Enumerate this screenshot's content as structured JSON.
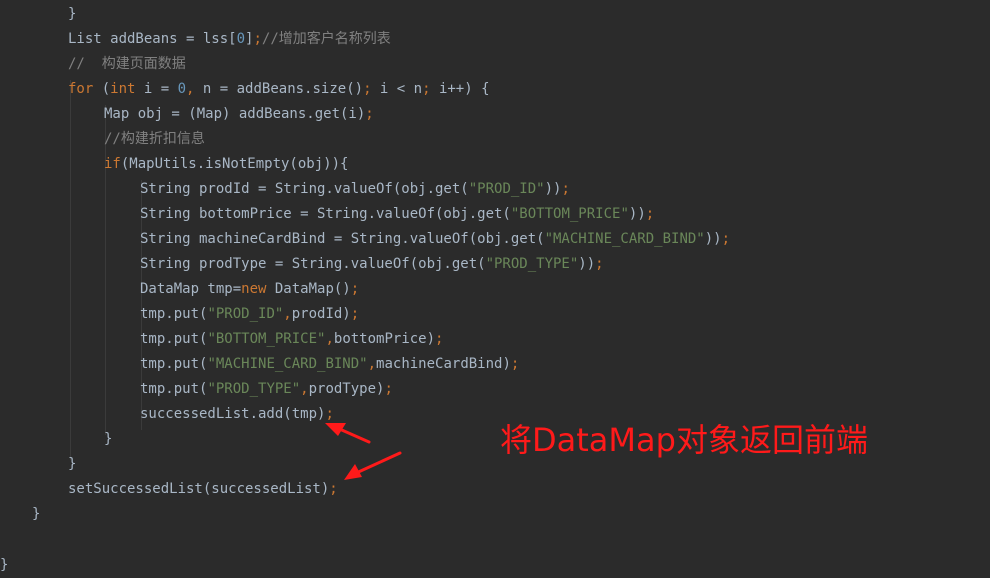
{
  "code_lines": [
    [
      {
        "t": "}",
        "c": "plain"
      }
    ],
    [
      {
        "t": "List addBeans = lss[",
        "c": "plain"
      },
      {
        "t": "0",
        "c": "num"
      },
      {
        "t": "]",
        "c": "plain"
      },
      {
        "t": ";",
        "c": "punc"
      },
      {
        "t": "//增加客户名称列表",
        "c": "cmt"
      }
    ],
    [
      {
        "t": "//  构建页面数据",
        "c": "cmt"
      }
    ],
    [
      {
        "t": "for",
        "c": "kw"
      },
      {
        "t": " (",
        "c": "plain"
      },
      {
        "t": "int",
        "c": "kw"
      },
      {
        "t": " i = ",
        "c": "plain"
      },
      {
        "t": "0",
        "c": "num"
      },
      {
        "t": ", ",
        "c": "punc"
      },
      {
        "t": "n = addBeans.size()",
        "c": "plain"
      },
      {
        "t": "; ",
        "c": "punc"
      },
      {
        "t": "i < n",
        "c": "plain"
      },
      {
        "t": "; ",
        "c": "punc"
      },
      {
        "t": "i++) {",
        "c": "plain"
      }
    ],
    [
      {
        "t": "Map obj = (Map) addBeans.get(i)",
        "c": "plain"
      },
      {
        "t": ";",
        "c": "punc"
      }
    ],
    [
      {
        "t": "//构建折扣信息",
        "c": "cmt"
      }
    ],
    [
      {
        "t": "if",
        "c": "kw"
      },
      {
        "t": "(MapUtils.isNotEmpty(obj)){",
        "c": "plain"
      }
    ],
    [
      {
        "t": "String prodId = String.valueOf(obj.get(",
        "c": "plain"
      },
      {
        "t": "\"PROD_ID\"",
        "c": "str"
      },
      {
        "t": "))",
        "c": "plain"
      },
      {
        "t": ";",
        "c": "punc"
      }
    ],
    [
      {
        "t": "String bottomPrice = String.valueOf(obj.get(",
        "c": "plain"
      },
      {
        "t": "\"BOTTOM_PRICE\"",
        "c": "str"
      },
      {
        "t": "))",
        "c": "plain"
      },
      {
        "t": ";",
        "c": "punc"
      }
    ],
    [
      {
        "t": "String machineCardBind = String.valueOf(obj.get(",
        "c": "plain"
      },
      {
        "t": "\"MACHINE_CARD_BIND\"",
        "c": "str"
      },
      {
        "t": "))",
        "c": "plain"
      },
      {
        "t": ";",
        "c": "punc"
      }
    ],
    [
      {
        "t": "String prodType = String.valueOf(obj.get(",
        "c": "plain"
      },
      {
        "t": "\"PROD_TYPE\"",
        "c": "str"
      },
      {
        "t": "))",
        "c": "plain"
      },
      {
        "t": ";",
        "c": "punc"
      }
    ],
    [
      {
        "t": "DataMap tmp=",
        "c": "plain"
      },
      {
        "t": "new",
        "c": "kw"
      },
      {
        "t": " DataMap()",
        "c": "plain"
      },
      {
        "t": ";",
        "c": "punc"
      }
    ],
    [
      {
        "t": "tmp.put(",
        "c": "plain"
      },
      {
        "t": "\"PROD_ID\"",
        "c": "str"
      },
      {
        "t": ",",
        "c": "punc"
      },
      {
        "t": "prodId)",
        "c": "plain"
      },
      {
        "t": ";",
        "c": "punc"
      }
    ],
    [
      {
        "t": "tmp.put(",
        "c": "plain"
      },
      {
        "t": "\"BOTTOM_PRICE\"",
        "c": "str"
      },
      {
        "t": ",",
        "c": "punc"
      },
      {
        "t": "bottomPrice)",
        "c": "plain"
      },
      {
        "t": ";",
        "c": "punc"
      }
    ],
    [
      {
        "t": "tmp.put(",
        "c": "plain"
      },
      {
        "t": "\"MACHINE_CARD_BIND\"",
        "c": "str"
      },
      {
        "t": ",",
        "c": "punc"
      },
      {
        "t": "machineCardBind)",
        "c": "plain"
      },
      {
        "t": ";",
        "c": "punc"
      }
    ],
    [
      {
        "t": "tmp.put(",
        "c": "plain"
      },
      {
        "t": "\"PROD_TYPE\"",
        "c": "str"
      },
      {
        "t": ",",
        "c": "punc"
      },
      {
        "t": "prodType)",
        "c": "plain"
      },
      {
        "t": ";",
        "c": "punc"
      }
    ],
    [
      {
        "t": "successedList.add(tmp)",
        "c": "plain"
      },
      {
        "t": ";",
        "c": "punc"
      }
    ],
    [
      {
        "t": "}",
        "c": "plain"
      }
    ],
    [
      {
        "t": "}",
        "c": "plain"
      }
    ],
    [
      {
        "t": "setSuccessedList(successedList)",
        "c": "plain"
      },
      {
        "t": ";",
        "c": "punc"
      }
    ],
    [
      {
        "t": "}",
        "c": "plain"
      }
    ],
    [
      {
        "t": "",
        "c": "plain"
      }
    ],
    [
      {
        "t": "}",
        "c": "plain"
      }
    ]
  ],
  "annotation": {
    "text": "将DataMap对象返回前端",
    "color": "#ff1a1a"
  },
  "colors": {
    "background": "#2b2b2b",
    "text": "#a9b7c6",
    "keyword": "#cc7832",
    "string": "#6a8759",
    "number": "#6897bb",
    "comment": "#808080"
  }
}
